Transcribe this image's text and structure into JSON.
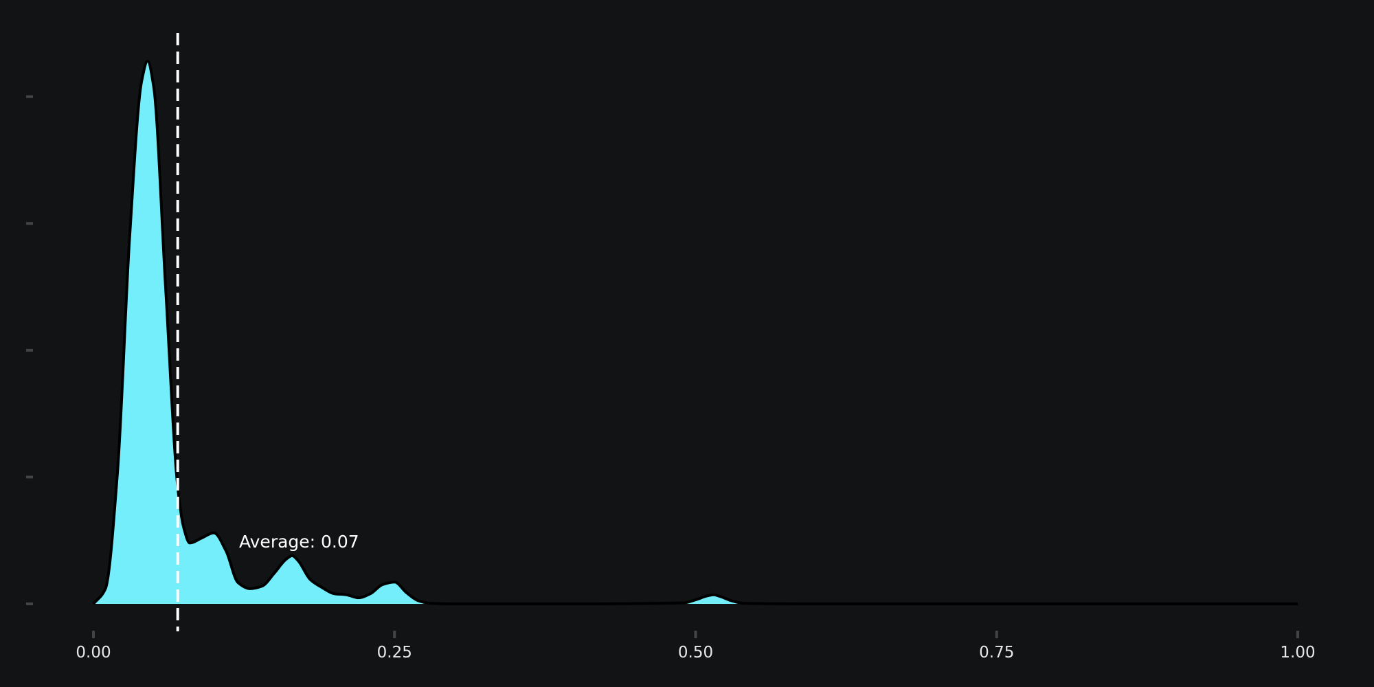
{
  "chart_data": {
    "type": "area",
    "title": "",
    "xlabel": "",
    "ylabel": "",
    "xlim": [
      0,
      1
    ],
    "ylim": [
      0,
      10.7
    ],
    "x_ticks": [
      0,
      0.25,
      0.5,
      0.75,
      1
    ],
    "x_tick_labels": [
      "0.00",
      "0.25",
      "0.50",
      "0.75",
      "1.00"
    ],
    "y_ticks": [
      0,
      2.5,
      5,
      7.5,
      10
    ],
    "y_tick_labels": [
      "",
      "",
      "",
      "",
      ""
    ],
    "grid": false,
    "legend": "none",
    "series": [
      {
        "x": [
          0.0,
          0.01,
          0.02,
          0.03,
          0.04,
          0.045,
          0.05,
          0.06,
          0.07,
          0.075,
          0.08,
          0.09,
          0.1,
          0.11,
          0.12,
          0.13,
          0.14,
          0.15,
          0.16,
          0.165,
          0.17,
          0.18,
          0.19,
          0.2,
          0.21,
          0.22,
          0.23,
          0.24,
          0.25,
          0.26,
          0.27,
          0.28,
          0.3,
          0.4,
          0.49,
          0.5,
          0.51,
          0.515,
          0.52,
          0.53,
          0.54,
          0.6,
          0.8,
          1.0
        ],
        "y": [
          0.0,
          0.3,
          2.6,
          7.2,
          10.3,
          10.7,
          10.2,
          6.2,
          2.3,
          1.5,
          1.2,
          1.3,
          1.4,
          1.05,
          0.42,
          0.3,
          0.35,
          0.6,
          0.88,
          0.95,
          0.85,
          0.48,
          0.32,
          0.2,
          0.18,
          0.12,
          0.2,
          0.38,
          0.43,
          0.22,
          0.06,
          0.01,
          0.0,
          0.0,
          0.02,
          0.08,
          0.16,
          0.18,
          0.15,
          0.06,
          0.01,
          0.0,
          0.0,
          0.0
        ]
      }
    ],
    "reference_lines": [
      {
        "orientation": "vertical",
        "x": 0.07,
        "style": "dashed",
        "label": "Average: 0.07"
      }
    ],
    "colors": {
      "background": "#121314",
      "fill": "#74EEFA",
      "outline": "#000000",
      "reference_line": "#FFFFFF",
      "tick_marks": "#444444",
      "text": "#E8E8E8"
    }
  }
}
